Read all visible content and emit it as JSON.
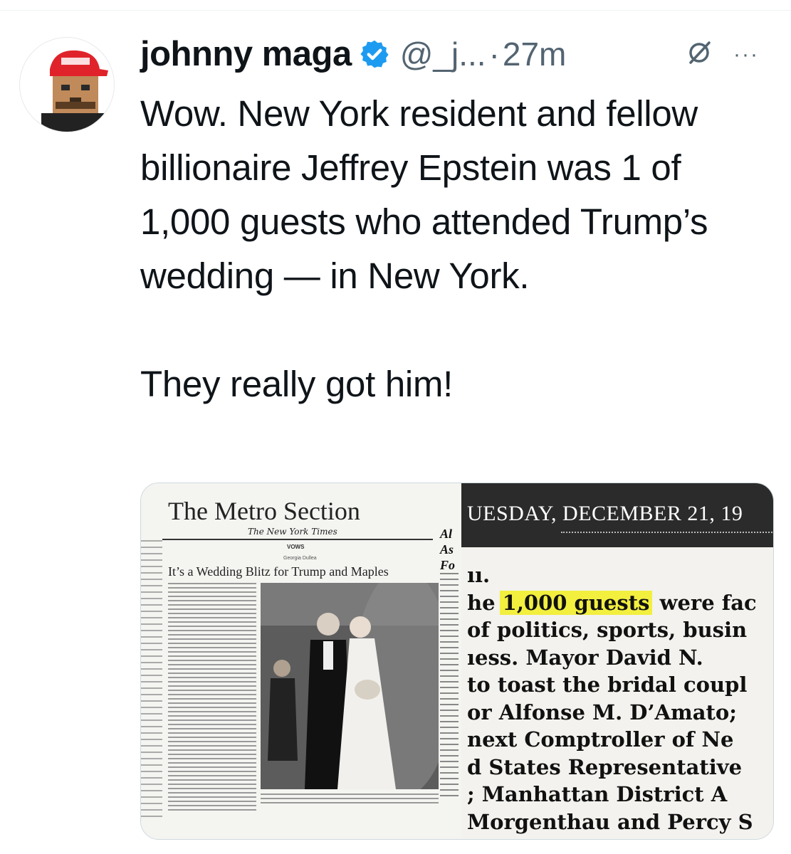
{
  "tweet": {
    "author_name": "johnny maga",
    "handle": "@_j...",
    "separator": "·",
    "time": "27m",
    "more_label": "···",
    "verified_icon": "verified-badge-icon",
    "text_paragraphs": [
      "Wow. New York resident and fellow billionaire Jeffrey Epstein was 1 of 1,000 guests who attended Trump’s wedding — in New York.",
      "They really got him!"
    ],
    "accent_color": "#1d9bf0"
  },
  "media": {
    "left_clipping": {
      "section_title": "The Metro Section",
      "masthead": "The New York Times",
      "column": "VOWS",
      "byline": "Georgia Dullea",
      "headline": "It’s a Wedding Blitz for Trump and Maples",
      "edge_letters": [
        "Al",
        "As",
        "Fo"
      ]
    },
    "right_zoom": {
      "date": "UESDAY, DECEMBER 21, 19",
      "lines": [
        "ıı.",
        "he 1,000 guests were fac",
        "of politics, sports, busin",
        "ıess. Mayor David N.",
        "to toast the bridal coupl",
        "or Alfonse M. D’Amato;",
        "next Comptroller of Ne",
        "d States Representative",
        "; Manhattan District A",
        "Morgenthau and Percy S"
      ],
      "highlight": "1,000 guests",
      "highlight_color": "#f2ef3f"
    }
  }
}
